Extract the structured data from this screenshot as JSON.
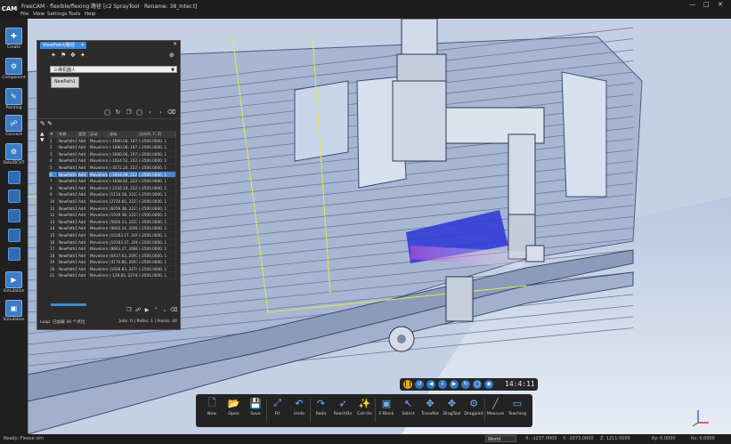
{
  "window": {
    "logo": "CAM",
    "title": "FreeCAM - flexible/flexing 路径 [c2 SprayTool · Rename: 38_Inter.t]",
    "controls": [
      "—",
      "□",
      "✕"
    ]
  },
  "menu": [
    "File",
    "View",
    "Settings",
    "Tools",
    "Help"
  ],
  "rail": [
    {
      "label": "Create"
    },
    {
      "label": "Component"
    },
    {
      "label": "Painting"
    },
    {
      "label": "Connect"
    },
    {
      "label": "RoboDCUT"
    },
    {
      "label": ""
    },
    {
      "label": ""
    },
    {
      "label": ""
    },
    {
      "label": ""
    },
    {
      "label": ""
    },
    {
      "label": "Simulation"
    },
    {
      "label": "Simulation"
    }
  ],
  "panel": {
    "tab_label": "ViewPoint/路径",
    "dropdown_value": "三维机器人",
    "path_button": "NewPath1",
    "columns": [
      "#",
      "名称",
      "类型",
      "运动",
      "坐标",
      "方向(X, Y, Z)"
    ],
    "rows": [
      [
        "1",
        "NewPath1-1",
        "Add",
        "Movelinm",
        "(-1980.00, 1975.00,",
        "(-2500.0000, 1"
      ],
      [
        "2",
        "NewPath1-2",
        "Add",
        "Movelinm",
        "(-1980.00, 1975.00,",
        "(-2500.0000, 1"
      ],
      [
        "3",
        "NewPath1-3",
        "Add",
        "Movelinm",
        "(-1980.00, 1975.00,",
        "(-2500.0000, 1"
      ],
      [
        "4",
        "NewPath1-4",
        "Add",
        "Movelinm",
        "(-1024.52, 2227.24,",
        "(-2500.0000, 1"
      ],
      [
        "5",
        "NewPath1-5",
        "Add",
        "Movelinm",
        "(-3572.24, 2227.24,",
        "(-2500.0000, 1"
      ],
      [
        "6",
        "NewPath1-6",
        "Add",
        "Movelinm",
        "(-1904.09, 2227.24,",
        "(-2500.0000, 1"
      ],
      [
        "7",
        "NewPath1-7",
        "Add",
        "Movelinm",
        "(-1648.82, 2227.24,",
        "(-2500.0000, 1"
      ],
      [
        "8",
        "NewPath1-8",
        "Add",
        "Movelinm",
        "(-2116.19, 2227.24,",
        "(-2500.0000, 1"
      ],
      [
        "9",
        "NewPath1-9",
        "Add",
        "Movelinm",
        "(1114.18, 2227.24, 1",
        "(-2500.0000, 1"
      ],
      [
        "10",
        "NewPath1-10",
        "Add",
        "Movelinm",
        "(2720.60, 2227.24, 1",
        "(-2500.0000, 1"
      ],
      [
        "11",
        "NewPath1-11",
        "Add",
        "Movelinm",
        "(6059.38, 2227.24, 1",
        "(-2500.0000, 1"
      ],
      [
        "12",
        "NewPath1-12",
        "Add",
        "Movelinm",
        "(1919.38, 2227.24, 1",
        "(-2500.0000, 1"
      ],
      [
        "13",
        "NewPath1-13",
        "Add",
        "Movelinm",
        "(5920.13, 2227.24, 1",
        "(-2500.0000, 1"
      ],
      [
        "14",
        "NewPath1-14",
        "Add",
        "Movelinm",
        "(9602.24, 2098.94, 1",
        "(-2500.0000, 1"
      ],
      [
        "15",
        "NewPath1-15",
        "Add",
        "Movelinm",
        "(10163.17, 2098.94,",
        "(-2500.0000, 1"
      ],
      [
        "16",
        "NewPath1-16",
        "Add",
        "Movelinm",
        "(10163.37, 2088.94,",
        "(-2500.0000, 1"
      ],
      [
        "17",
        "NewPath1-17",
        "Add",
        "Movelinm",
        "(8663.27, 2088.94, 1",
        "(-2500.0000, 1"
      ],
      [
        "18",
        "NewPath1-18",
        "Add",
        "Movelinm",
        "(6417.03, 2093.24, 1",
        "(-2500.0000, 1"
      ],
      [
        "19",
        "NewPath1-19",
        "Add",
        "Movelinm",
        "(4170.80, 2093.24, 1",
        "(-2500.0000, 1"
      ],
      [
        "20",
        "NewPath1-20",
        "Add",
        "Movelinm",
        "(1926.83, 2274.83, 1",
        "(-2500.0000, 1"
      ],
      [
        "21",
        "NewPath1-21",
        "Add",
        "Movelinm",
        "(-129.83, 2274.83, 1",
        "(-2500.0000, 1"
      ]
    ],
    "selected_row": 5,
    "status_left": "Loop: 已加载 46 个点位",
    "status_right": "Jobs: 0 | Paths: 1 | Points: 46"
  },
  "playback": {
    "timecode": "14:4:11"
  },
  "toolbar": [
    {
      "label": "New",
      "icon": "new-file-icon",
      "glyph": "🗋"
    },
    {
      "label": "Open",
      "icon": "folder-icon",
      "glyph": "📂"
    },
    {
      "label": "Save",
      "icon": "save-icon",
      "glyph": "💾"
    },
    {
      "label": "Fit",
      "icon": "fit-icon",
      "glyph": "⤢"
    },
    {
      "label": "Undo",
      "icon": "undo-icon",
      "glyph": "↶"
    },
    {
      "label": "Redo",
      "icon": "redo-icon",
      "glyph": "↷"
    },
    {
      "label": "ReachOn",
      "icon": "reach-icon",
      "glyph": "➶"
    },
    {
      "label": "Coll-On",
      "icon": "collision-icon",
      "glyph": "✨"
    },
    {
      "label": "F-Block",
      "icon": "block-icon",
      "glyph": "▣"
    },
    {
      "label": "Select",
      "icon": "select-icon",
      "glyph": "↖"
    },
    {
      "label": "TransRot",
      "icon": "transform-icon",
      "glyph": "✥"
    },
    {
      "label": "DragTool",
      "icon": "drag-icon",
      "glyph": "✥"
    },
    {
      "label": "Dragjoint",
      "icon": "joint-icon",
      "glyph": "⚙"
    },
    {
      "label": "Measure",
      "icon": "measure-icon",
      "glyph": "╱"
    },
    {
      "label": "Teaching",
      "icon": "teaching-icon",
      "glyph": "▭"
    }
  ],
  "status": {
    "left": "Ready: Please sim",
    "world": "World",
    "x": "X: -1237.0000",
    "y": "Y: -2073.0000",
    "z": "Z: 1211.0000",
    "extra1": "Ry: 0.0000",
    "extra2": "Rz: 0.0000"
  },
  "colors": {
    "accent": "#3d8ad8",
    "highlight": "#2a35d8",
    "pause": "#e4a91a"
  }
}
